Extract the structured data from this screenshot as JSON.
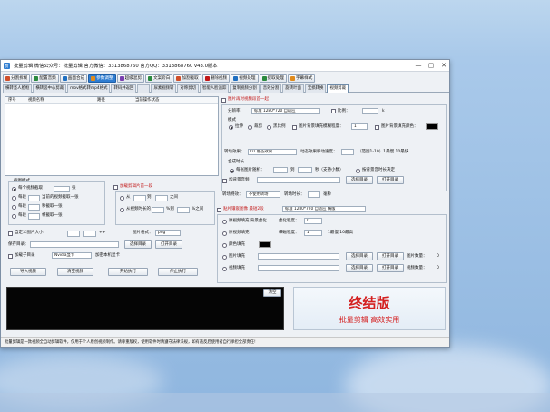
{
  "window": {
    "title": "批量剪辑 微信公众号：批量剪辑 官方微信：3313868760 官方QQ：3313868760 v43.0版本",
    "controls": [
      "—",
      "▢",
      "✕"
    ]
  },
  "toolbar": [
    {
      "label": "分割拆帧",
      "icon": "scissors-icon",
      "color": "#d14f2a"
    },
    {
      "label": "配置音频",
      "icon": "audio-icon",
      "color": "#2b8a3e"
    },
    {
      "label": "画面合成",
      "icon": "merge-icon",
      "color": "#1f6fc1"
    },
    {
      "label": "参数调整",
      "icon": "settings-icon",
      "color": "#e08b1d",
      "active": true
    },
    {
      "label": "超级混剪",
      "icon": "mix-icon",
      "color": "#7a3fb0"
    },
    {
      "label": "文案旁白",
      "icon": "text-icon",
      "color": "#2b8a3e"
    },
    {
      "label": "加割截取",
      "icon": "cut-icon",
      "color": "#d14f2a"
    },
    {
      "label": "删除视频",
      "icon": "delete-icon",
      "color": "#c21818"
    },
    {
      "label": "视频处理",
      "icon": "video-icon",
      "color": "#1f6fc1"
    },
    {
      "label": "提取处理",
      "icon": "extract-icon",
      "color": "#2b8a3e"
    },
    {
      "label": "字幕样式",
      "icon": "subtitle-icon",
      "color": "#e08b1d"
    }
  ],
  "tabs": [
    "横转竖人脸框",
    "横转竖中心剪裁",
    "mov格式转mp4格式",
    "转码并返回",
    "",
    "尿素视频转",
    "对称剪切",
    "智能人脸追踪",
    "复制视频分割",
    "音效分割",
    "旋转叶面",
    "无损转换",
    "视频剪裁"
  ],
  "active_tab": 12,
  "list": {
    "headers": [
      "序号",
      "视频名称",
      "路径",
      "当前操作状态"
    ]
  },
  "trim": {
    "group_label": "截图模式",
    "options": [
      "每个视频截取",
      "每段",
      "每段",
      "每段"
    ],
    "suffixes": [
      "张",
      "当前的视频截取一张",
      "秒截取一张",
      "帧截取一张"
    ],
    "custom_chk": "自定义图片大小：",
    "custom_w": "",
    "custom_h": "",
    "size_sep": "++",
    "save_label": "保存目录：",
    "save_value": "",
    "img_fmt_label": "图片格式：",
    "img_fmt_value": "png",
    "select_dir": "选择目录",
    "open_dir": "打开目录",
    "add_watermark": "加载剪辑片首一段",
    "from_label": "从",
    "to_label": "到",
    "between_label": "之间",
    "random_label": "从视频时长的",
    "pct_label": "%到",
    "pct2_label": "%之间",
    "nvidia_chk": "加载子目录",
    "nvidia_value": "Nvidia显卡",
    "hw_label": "加密本机显卡",
    "btn_import": "导入视频",
    "btn_clear": "清空视频",
    "btn_start": "开始执行",
    "btn_stop": "停止执行"
  },
  "right": {
    "head_chk": "图片再对视频段首一起",
    "res_label": "分辨率：",
    "res_value": "标准 1280*720 自适应",
    "ratio_label": "比例：",
    "ratio_value": "",
    "ratio_unit": "k",
    "mode_label": "模式",
    "mode_opts": [
      "拉伸",
      "裁剪",
      "黑比例"
    ],
    "fill_chk": "图片背景填充模糊程度：",
    "fill_val": "1",
    "bgcolor_chk": "图片背景填充颜色：",
    "trans_label": "转场效果：",
    "trans_value": "01.静态效果",
    "trans_speed_label": "动态效果移动速度：",
    "trans_speed_value": "",
    "speed_hint": "（范围1-10）1最慢 10最快",
    "dur_label": "合成时长",
    "dur_opts": [
      "每张图片随机：",
      "按背景音时长决定"
    ],
    "dur_mid": "到",
    "dur_unit": "秒（支持小数）",
    "bg_chk": "加背景音频：",
    "bg_select": "选择目录",
    "bg_open": "打开目录",
    "fade_label": "转场特效：",
    "fade_value": "不使用转场",
    "fade_dur_label": "转场时长：",
    "fade_dur_unit": "毫秒",
    "clip_chk": "贴片镶嵌图像 最短2段",
    "clip_res": "标准 1280*720 自适应 横版",
    "clip_opts": [
      "原视频填充 背景虚化",
      "原视频填充",
      "颜色填充",
      "图片填充",
      "视频填充"
    ],
    "blur_label": "虚化程度：",
    "blur_value": "0",
    "blur2_label": "细磁程度：",
    "blur2_value": "1",
    "blur2_hint": "1最慢 10最高",
    "img_select": "选择目录",
    "img_open": "打开目录",
    "img_count_label": "图片数量：",
    "img_count_value": "0",
    "vid_select": "选择目录",
    "vid_open": "打开目录",
    "vid_count_label": "视频数量：",
    "vid_count_value": "0"
  },
  "console": {
    "clear_label": "清空"
  },
  "banner": {
    "title": "终结版",
    "subtitle": "批量剪辑 高效实用"
  },
  "statusbar": "批量剪辑是一款视频全自动剪辑软件，仅用于个人原创视频制作。请尊重版权，使用软件时请遵守法律法规，如有违反后使用者自行承担全部责任!"
}
